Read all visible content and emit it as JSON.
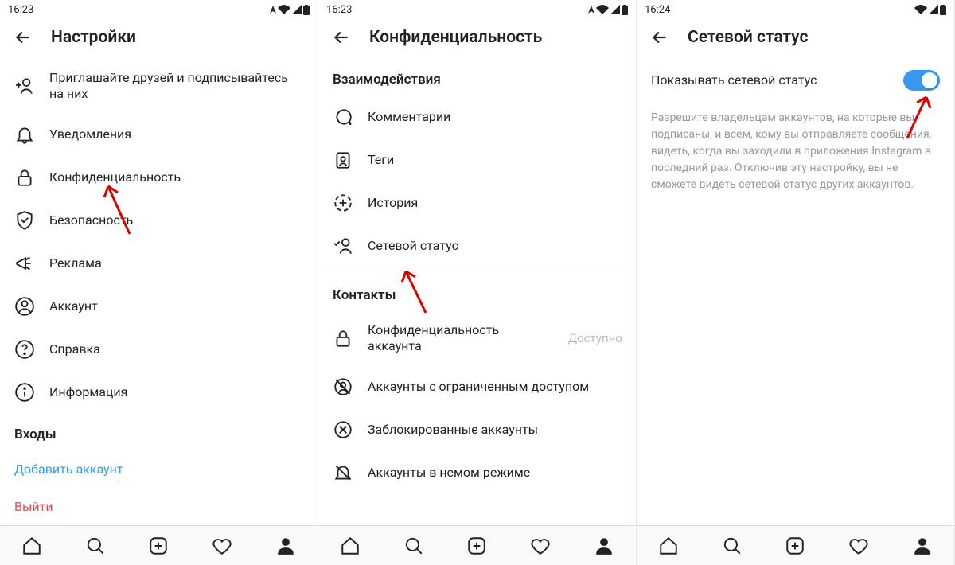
{
  "screens": [
    {
      "time": "16:23",
      "title": "Настройки",
      "items": [
        {
          "icon": "add-user",
          "label": "Приглашайте друзей и подписывайтесь на них"
        },
        {
          "icon": "bell",
          "label": "Уведомления"
        },
        {
          "icon": "lock",
          "label": "Конфиденциальность"
        },
        {
          "icon": "shield",
          "label": "Безопасность"
        },
        {
          "icon": "megaphone",
          "label": "Реклама"
        },
        {
          "icon": "user-circle",
          "label": "Аккаунт"
        },
        {
          "icon": "help",
          "label": "Справка"
        },
        {
          "icon": "info",
          "label": "Информация"
        }
      ],
      "section": "Входы",
      "add_account": "Добавить аккаунт",
      "logout": "Выйти"
    },
    {
      "time": "16:23",
      "title": "Конфиденциальность",
      "section1": "Взаимодействия",
      "items1": [
        {
          "icon": "comment",
          "label": "Комментарии"
        },
        {
          "icon": "tag",
          "label": "Теги"
        },
        {
          "icon": "story",
          "label": "История"
        },
        {
          "icon": "activity",
          "label": "Сетевой статус"
        }
      ],
      "section2": "Контакты",
      "items2": [
        {
          "icon": "lock",
          "label": "Конфиденциальность аккаунта",
          "sub": "Доступно"
        },
        {
          "icon": "restrict",
          "label": "Аккаунты с ограниченным доступом"
        },
        {
          "icon": "block",
          "label": "Заблокированные аккаунты"
        },
        {
          "icon": "mute",
          "label": "Аккаунты в немом режиме"
        }
      ]
    },
    {
      "time": "16:24",
      "title": "Сетевой статус",
      "toggle_label": "Показывать сетевой статус",
      "description": "Разрешите владельцам аккаунтов, на которые вы подписаны, и всем, кому вы отправляете сообщения, видеть, когда вы заходили в приложения Instagram в последний раз. Отключив эту настройку, вы не сможете видеть сетевой статус других аккаунтов."
    }
  ]
}
